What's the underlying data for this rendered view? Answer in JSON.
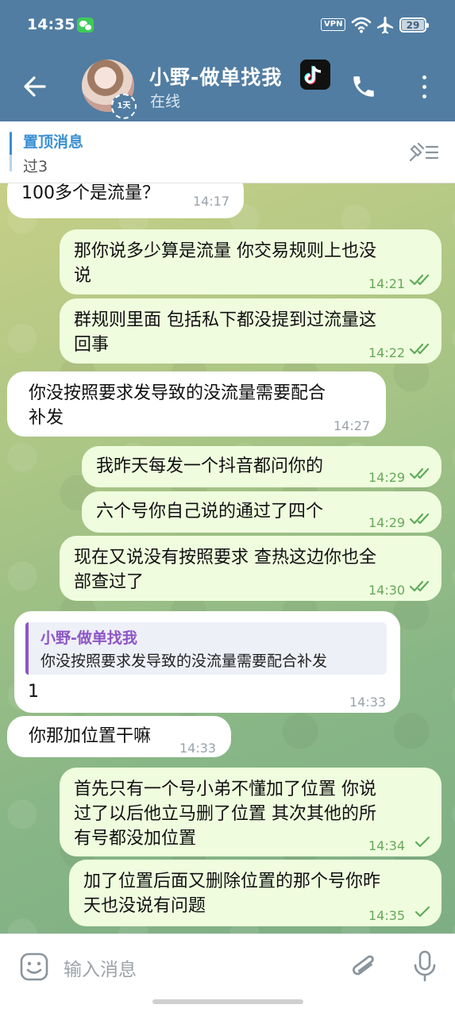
{
  "status_bar": {
    "time": "14:35",
    "vpn": "VPN",
    "battery": "29"
  },
  "header": {
    "title": "小野-做单找我",
    "status": "在线",
    "avatar_badge": "1天"
  },
  "pinned": {
    "title": "置顶消息",
    "text": "过3"
  },
  "messages": [
    {
      "dir": "in",
      "lines": [
        "100多个是流量？"
      ],
      "time": "14:17"
    },
    {
      "dir": "out",
      "lines": [
        "那你说多少算是流量  你交易规则上也没",
        "说"
      ],
      "time": "14:21",
      "read": true
    },
    {
      "dir": "out",
      "lines": [
        "群规则里面  包括私下都没提到过流量这",
        "回事"
      ],
      "time": "14:22",
      "read": true
    },
    {
      "dir": "in",
      "lines": [
        "你没按照要求发导致的没流量需要配合",
        "补发"
      ],
      "time": "14:27"
    },
    {
      "dir": "out",
      "lines": [
        "我昨天每发一个抖音都问你的"
      ],
      "time": "14:29",
      "read": true
    },
    {
      "dir": "out",
      "lines": [
        "六个号你自己说的通过了四个"
      ],
      "time": "14:29",
      "read": true
    },
    {
      "dir": "out",
      "lines": [
        "现在又说没有按照要求  查热这边你也全",
        "部查过了"
      ],
      "time": "14:30",
      "read": true
    },
    {
      "dir": "in",
      "reply": {
        "name": "小野-做单找我",
        "text": "你没按照要求发导致的没流量需要配合补发"
      },
      "lines": [
        "1"
      ],
      "time": "14:33"
    },
    {
      "dir": "in",
      "lines": [
        "你那加位置干嘛"
      ],
      "time": "14:33"
    },
    {
      "dir": "out",
      "lines": [
        "首先只有一个号小弟不懂加了位置  你说",
        "过了以后他立马删了位置  其次其他的所",
        "有号都没加位置"
      ],
      "time": "14:34",
      "read": false
    },
    {
      "dir": "out",
      "lines": [
        "加了位置后面又删除位置的那个号你昨",
        "天也没说有问题"
      ],
      "time": "14:35",
      "read": false
    }
  ],
  "input": {
    "placeholder": "输入消息"
  }
}
